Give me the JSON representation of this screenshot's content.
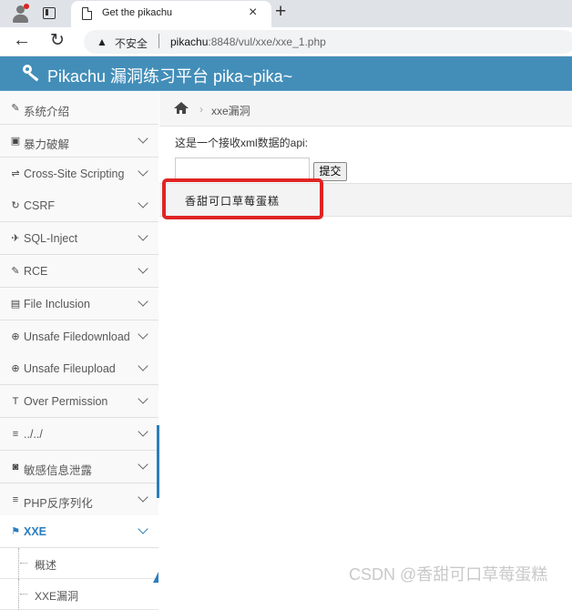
{
  "browser": {
    "tab_title": "Get the pikachu",
    "tab_close": "×",
    "new_tab": "+",
    "insecure_label": "不安全",
    "url_host": "pikachu",
    "url_rest": ":8848/vul/xxe/xxe_1.php",
    "back": "←",
    "reload": "↻",
    "warning_glyph": "▲"
  },
  "header": {
    "title": "Pikachu 漏洞练习平台 pika~pika~",
    "color": "#438eb9"
  },
  "sidebar": {
    "items": [
      {
        "label": "系统介绍",
        "icon": "tag-icon",
        "glyph": "✎"
      },
      {
        "label": "暴力破解",
        "icon": "lock-icon",
        "glyph": "▣"
      },
      {
        "label": "Cross-Site Scripting",
        "icon": "sliders-icon",
        "glyph": "⇌"
      },
      {
        "label": "CSRF",
        "icon": "refresh-icon",
        "glyph": "↻"
      },
      {
        "label": "SQL-Inject",
        "icon": "plane-icon",
        "glyph": "✈"
      },
      {
        "label": "RCE",
        "icon": "pencil-icon",
        "glyph": "✎"
      },
      {
        "label": "File Inclusion",
        "icon": "file-icon",
        "glyph": "▤"
      },
      {
        "label": "Unsafe Filedownload",
        "icon": "download-icon",
        "glyph": "⊕"
      },
      {
        "label": "Unsafe Fileupload",
        "icon": "upload-icon",
        "glyph": "⊕"
      },
      {
        "label": "Over Permission",
        "icon": "text-icon",
        "glyph": "T"
      },
      {
        "label": "../../",
        "icon": "list-icon",
        "glyph": "≡"
      },
      {
        "label": "敏感信息泄露",
        "icon": "camera-icon",
        "glyph": "◙"
      },
      {
        "label": "PHP反序列化",
        "icon": "list-icon",
        "glyph": "≡"
      },
      {
        "label": "XXE",
        "icon": "flag-icon",
        "glyph": "⚑"
      }
    ],
    "sub_items": [
      {
        "label": "概述"
      },
      {
        "label": "XXE漏洞"
      }
    ],
    "accent": "#2b7dbc"
  },
  "breadcrumb": {
    "separator": "›",
    "current": "xxe漏洞"
  },
  "main": {
    "api_text": "这是一个接收xml数据的api:",
    "input_value": "",
    "submit_label": "提交",
    "result_text": "香甜可口草莓蛋糕",
    "highlight_color": "#e02424"
  },
  "watermark": "CSDN @香甜可口草莓蛋糕"
}
